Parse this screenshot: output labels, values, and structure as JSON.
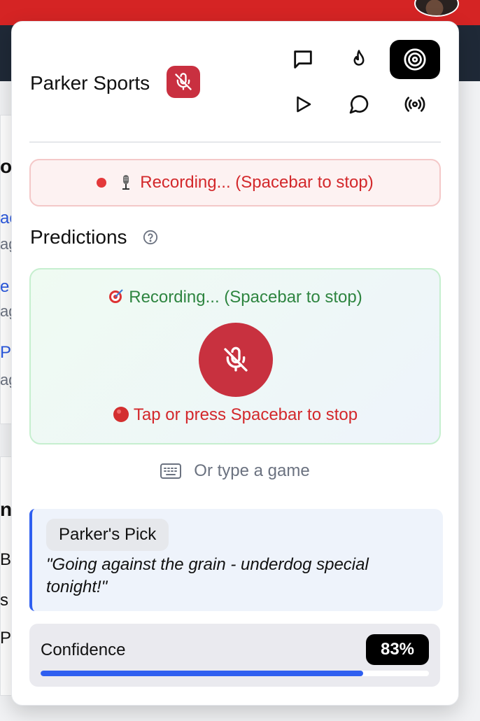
{
  "header": {
    "brand": "Parker Sports",
    "icons": [
      "message-square-icon",
      "flame-icon",
      "target-icon",
      "play-icon",
      "message-circle-icon",
      "broadcast-icon"
    ],
    "active_icon": "target-icon"
  },
  "recording_banner": {
    "text": "Recording... (Spacebar to stop)"
  },
  "predictions": {
    "title": "Predictions",
    "listen_status": "Recording... (Spacebar to stop)",
    "hint": "Tap or press Spacebar to stop",
    "type_label": "Or type a game"
  },
  "pick": {
    "badge": "Parker's Pick",
    "quote": "\"Going against the grain - underdog special tonight!\""
  },
  "confidence": {
    "label": "Confidence",
    "value_text": "83%",
    "value": 0.83
  },
  "background": {
    "line1": "o",
    "line2": "ac",
    "line3": "ag",
    "line4": "e",
    "line5": "ag",
    "line6": "P",
    "line7": "ag",
    "line8": "ni",
    "line9": "B",
    "line10": "s",
    "line11": "P"
  },
  "colors": {
    "brand_red": "#d52424",
    "mic_red": "#c8313f",
    "accent_blue": "#2f5ff0",
    "success_green": "#2e8540"
  }
}
